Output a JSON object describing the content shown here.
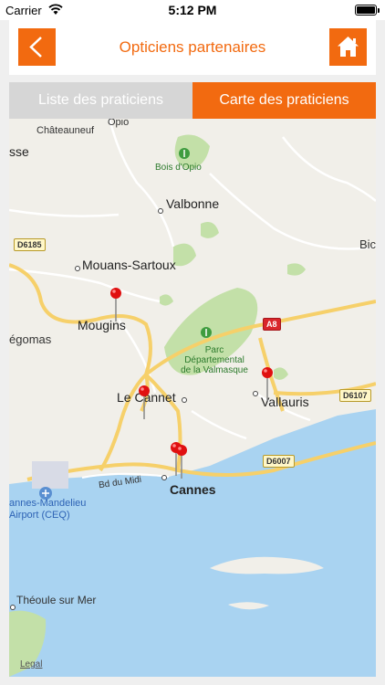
{
  "status_bar": {
    "carrier": "Carrier",
    "time": "5:12 PM"
  },
  "header": {
    "title": "Opticiens partenaires"
  },
  "tabs": [
    {
      "label": "Liste des praticiens",
      "active": false
    },
    {
      "label": "Carte des praticiens",
      "active": true
    }
  ],
  "map": {
    "places": {
      "chateauneuf": "Châteauneuf",
      "opio": "Opio",
      "grasse": "sse",
      "bois_opio": "Bois d'Opio",
      "valbonne": "Valbonne",
      "biot": "Bic",
      "mouans": "Mouans-Sartoux",
      "mougins": "Mougins",
      "pegomas": "égomas",
      "parc": "Parc\nDépartemental\nde la Valmasque",
      "le_cannet": "Le Cannet",
      "vallauris": "Vallauris",
      "cannes": "Cannes",
      "bd_midi": "Bd du Midi",
      "airport": "annes-Mandelieu\nAirport (CEQ)",
      "theoule": "Théoule sur Mer"
    },
    "roads": {
      "d6185": "D6185",
      "a8": "A8",
      "d6107": "D6107",
      "d6007": "D6007"
    },
    "legal": "Legal",
    "pin_count": 5
  },
  "colors": {
    "accent": "#f26a10",
    "water": "#a9d3f1",
    "park": "#c3e0a8",
    "road_major": "#f6d06a"
  }
}
